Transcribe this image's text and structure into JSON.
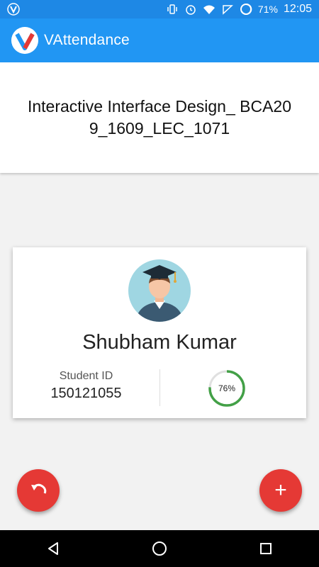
{
  "status_bar": {
    "battery": "71%",
    "time": "12:05",
    "icons": [
      "app-v-icon",
      "vibrate-icon",
      "alarm-icon",
      "wifi-icon",
      "data-saver-icon",
      "battery-icon"
    ]
  },
  "app_bar": {
    "title": "VAttendance",
    "logo_icon": "v-logo-icon"
  },
  "course": {
    "title": "Interactive Interface Design_ BCA209_1609_LEC_1071"
  },
  "student": {
    "name": "Shubham Kumar",
    "id_label": "Student ID",
    "id_value": "150121055",
    "attendance_percent": 76,
    "attendance_text": "76%",
    "avatar_icon": "graduate-avatar-icon"
  },
  "actions": {
    "undo_icon": "undo-icon",
    "add_icon": "add-icon",
    "add_label": "+"
  },
  "navigation": {
    "icons": [
      "back-icon",
      "home-icon",
      "recents-icon"
    ]
  },
  "colors": {
    "status_bar": "#1e88e5",
    "app_bar": "#2196f3",
    "fab": "#e53935",
    "progress": "#43a047"
  }
}
